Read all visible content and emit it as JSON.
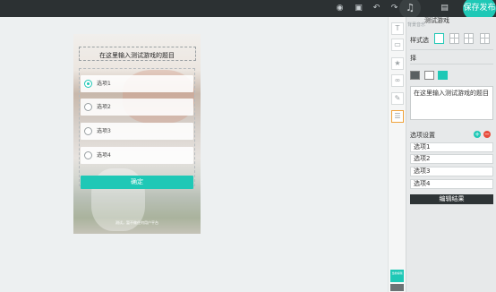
{
  "topbar": {
    "icons": [
      "eye-icon",
      "preview-icon",
      "undo-icon",
      "redo-icon",
      "music-icon",
      "save-icon"
    ],
    "publish_label": "保存发布"
  },
  "canvas": {
    "question_title": "在这里输入测试游戏的题目",
    "options": [
      "选项1",
      "选项2",
      "选项3",
      "选项4"
    ],
    "selected_option": 0,
    "submit_label": "确定",
    "footer_text": "测试，暂不做任何用户平台"
  },
  "toolstrip": {
    "tools": [
      "text-icon",
      "image-icon",
      "star-icon",
      "link-icon",
      "pen-icon",
      "form-icon"
    ],
    "bottom_label": "当前编辑"
  },
  "panel": {
    "header_title": "测试游戏",
    "header_tab": "背景音乐",
    "style_label": "样式选",
    "section_label": "择",
    "swatch_colors": [
      "#5a5f61",
      "#ffffff",
      "#1fc8b6"
    ],
    "question_text": "在这里输入测试游戏的题目",
    "options_label": "选项设置",
    "option_values": [
      "选项1",
      "选项2",
      "选项3",
      "选项4"
    ],
    "edit_result_label": "编辑结果",
    "accent": "#1fc8b6",
    "remove_color": "#e74c3c"
  }
}
